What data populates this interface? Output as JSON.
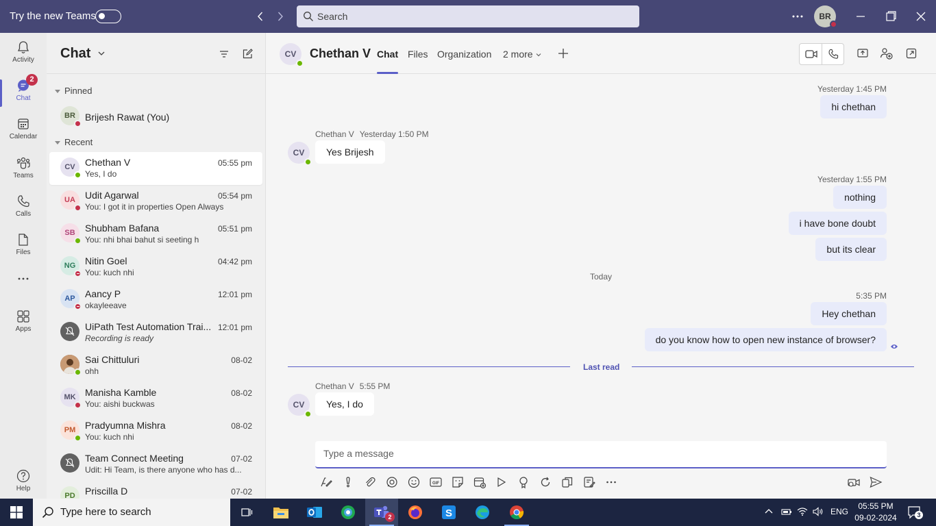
{
  "titlebar": {
    "try_new_teams": "Try the new Teams",
    "search_placeholder": "Search",
    "user_initials": "BR"
  },
  "rail": {
    "items": [
      {
        "label": "Activity",
        "icon": "bell-icon"
      },
      {
        "label": "Chat",
        "icon": "chat-icon",
        "badge": "2"
      },
      {
        "label": "Calendar",
        "icon": "calendar-icon"
      },
      {
        "label": "Teams",
        "icon": "teams-icon"
      },
      {
        "label": "Calls",
        "icon": "phone-icon"
      },
      {
        "label": "Files",
        "icon": "file-icon"
      },
      {
        "label": "Apps",
        "icon": "apps-icon"
      },
      {
        "label": "Help",
        "icon": "help-icon"
      }
    ]
  },
  "chatlist": {
    "title": "Chat",
    "pinned_label": "Pinned",
    "recent_label": "Recent",
    "pinned": {
      "initials": "BR",
      "name": "Brijesh Rawat (You)",
      "status": "busy"
    },
    "chats": [
      {
        "initials": "CV",
        "name": "Chethan V",
        "preview": "Yes, I do",
        "time": "05:55 pm",
        "status": "avail",
        "bg": "#e6e2f0",
        "fg": "#55536b"
      },
      {
        "initials": "UA",
        "name": "Udit Agarwal",
        "preview": "You: I got it in properties Open Always",
        "time": "05:54 pm",
        "status": "busy",
        "bg": "#f9dfe0",
        "fg": "#c43e55"
      },
      {
        "initials": "SB",
        "name": "Shubham Bafana",
        "preview": "You: nhi bhai bahut si seeting h",
        "time": "05:51 pm",
        "status": "avail",
        "bg": "#f6dfe8",
        "fg": "#b0457a"
      },
      {
        "initials": "NG",
        "name": "Nitin Goel",
        "preview": "You: kuch nhi",
        "time": "04:42 pm",
        "status": "dnd",
        "bg": "#d6ece4",
        "fg": "#2e7d5b"
      },
      {
        "initials": "AP",
        "name": "Aancy P",
        "preview": "okayleeave",
        "time": "12:01 pm",
        "status": "dnd",
        "bg": "#d8e3f3",
        "fg": "#2f5a9e"
      },
      {
        "initials": "",
        "name": "UiPath Test Automation Trai...",
        "preview": "Recording is ready",
        "time": "12:01 pm",
        "status": "",
        "bg": "#616161",
        "fg": "#fff"
      },
      {
        "initials": "",
        "name": "Sai Chittuluri",
        "preview": "ohh",
        "time": "08-02",
        "status": "avail",
        "bg": "#8a5a3c",
        "fg": "#fff"
      },
      {
        "initials": "MK",
        "name": "Manisha Kamble",
        "preview": "You: aishi buckwas",
        "time": "08-02",
        "status": "busy",
        "bg": "#e6e2f0",
        "fg": "#55536b"
      },
      {
        "initials": "PM",
        "name": "Pradyumna Mishra",
        "preview": "You: kuch nhi",
        "time": "08-02",
        "status": "avail",
        "bg": "#fbe3da",
        "fg": "#c25a2f"
      },
      {
        "initials": "",
        "name": "Team Connect Meeting",
        "preview": "Udit: Hi Team, is there anyone who has d...",
        "time": "07-02",
        "status": "",
        "bg": "#616161",
        "fg": "#fff"
      },
      {
        "initials": "PD",
        "name": "Priscilla D",
        "preview": "",
        "time": "07-02",
        "status": "",
        "bg": "#e3eedc",
        "fg": "#4b7a2c"
      }
    ]
  },
  "conversation": {
    "initials": "CV",
    "name": "Chethan V",
    "tabs": [
      "Chat",
      "Files",
      "Organization",
      "2 more"
    ],
    "today_label": "Today",
    "last_read_label": "Last read",
    "compose_placeholder": "Type a message",
    "messages": {
      "m1_time": "Yesterday 1:45 PM",
      "m1_text": "hi chethan",
      "m2_sender": "Chethan V",
      "m2_time": "Yesterday 1:50 PM",
      "m2_text": "Yes Brijesh",
      "m3_time": "Yesterday 1:55 PM",
      "m3_text1": "nothing",
      "m3_text2": "i have bone doubt",
      "m3_text3": "but its clear",
      "m4_time": "5:35 PM",
      "m4_text1": "Hey chethan",
      "m4_text2": "do you know how to open new instance of browser?",
      "m5_sender": "Chethan V",
      "m5_time": "5:55 PM",
      "m5_text": "Yes, I do"
    }
  },
  "taskbar": {
    "search_placeholder": "Type here to search",
    "language": "ENG",
    "time": "05:55 PM",
    "date": "09-02-2024",
    "notifications": "3",
    "teams_badge": "2"
  },
  "colors": {
    "titlebar": "#464775",
    "accent": "#5b5fc7",
    "available": "#6bb700",
    "busy": "#c4314b",
    "my_bubble": "#e8ebfa"
  }
}
